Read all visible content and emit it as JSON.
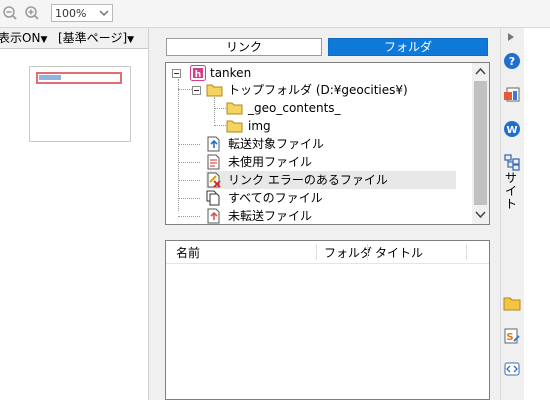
{
  "toolbar": {
    "zoom_value": "100%"
  },
  "left_pane": {
    "display_toggle": "表示ON",
    "base_page_select": "[基準ページ]"
  },
  "tabs": {
    "link": "リンク",
    "folder": "フォルダ"
  },
  "tree": {
    "root": "tanken",
    "top_folder": "トップフォルダ (D:¥geocities¥)",
    "sub_folders": [
      "_geo_contents_",
      "img"
    ],
    "special": [
      "転送対象ファイル",
      "未使用ファイル",
      "リンク エラーのあるファイル",
      "すべてのファイル",
      "未転送ファイル"
    ]
  },
  "list": {
    "columns": [
      "名前",
      "フォルダ",
      "タイトル"
    ]
  },
  "side_panel": {
    "site_label": "サイト"
  },
  "colors": {
    "accent": "#0f79d9",
    "folder_yellow": "#f4d35e",
    "root_pink": "#d83b8b"
  }
}
